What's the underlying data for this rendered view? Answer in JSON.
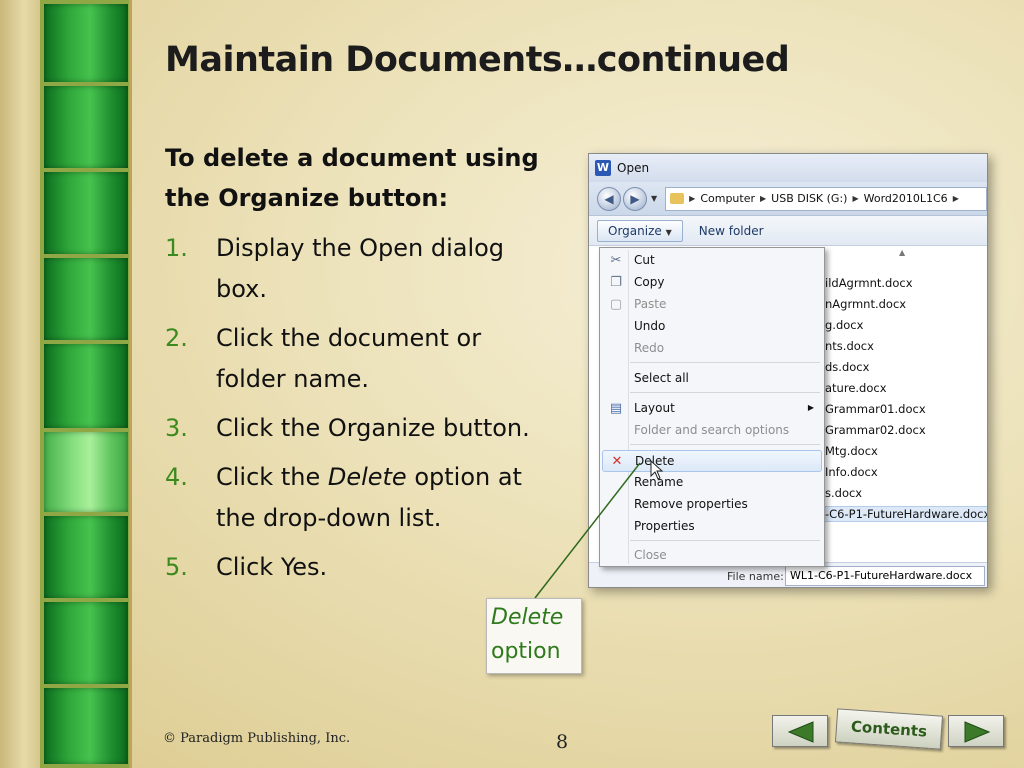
{
  "slide": {
    "title": "Maintain Documents…continued",
    "intro_line1": "To delete a document using",
    "intro_line2": "the Organize button:",
    "steps": [
      {
        "num": "1.",
        "line1": "Display the Open dialog",
        "line2": "box."
      },
      {
        "num": "2.",
        "line1": "Click the document or",
        "line2": "folder name."
      },
      {
        "num": "3.",
        "line1": "Click the Organize button."
      },
      {
        "num": "4.",
        "pre": "Click the ",
        "italic": "Delete",
        "post": " option at",
        "line2": "the drop-down list."
      },
      {
        "num": "5.",
        "line1": "Click Yes."
      }
    ]
  },
  "dialog": {
    "title": "Open",
    "app_icon_letter": "W",
    "breadcrumb": [
      "Computer",
      "USB DISK (G:)",
      "Word2010L1C6"
    ],
    "toolbar": {
      "organize": "Organize",
      "new_folder": "New folder"
    },
    "menu": {
      "cut": "Cut",
      "copy": "Copy",
      "paste": "Paste",
      "undo": "Undo",
      "redo": "Redo",
      "select_all": "Select all",
      "layout": "Layout",
      "folder_options": "Folder and search options",
      "delete": "Delete",
      "rename": "Rename",
      "remove_properties": "Remove properties",
      "properties": "Properties",
      "close": "Close"
    },
    "files": [
      "ildAgrmnt.docx",
      "nAgrmnt.docx",
      "g.docx",
      "nts.docx",
      "ds.docx",
      "ature.docx",
      "Grammar01.docx",
      "Grammar02.docx",
      "Mtg.docx",
      "Info.docx",
      "s.docx",
      "-C6-P1-FutureHardware.docx"
    ],
    "file_name_label": "File name:",
    "file_name_value": "WL1-C6-P1-FutureHardware.docx"
  },
  "callout": {
    "line1": "Delete",
    "line2": "option"
  },
  "footer": {
    "copyright": "© Paradigm Publishing, Inc.",
    "page": "8",
    "contents_label": "Contents"
  },
  "colors": {
    "step_number": "#3b8a1e",
    "callout_text": "#2f7a1c",
    "strip_green": "#2fa83a"
  }
}
